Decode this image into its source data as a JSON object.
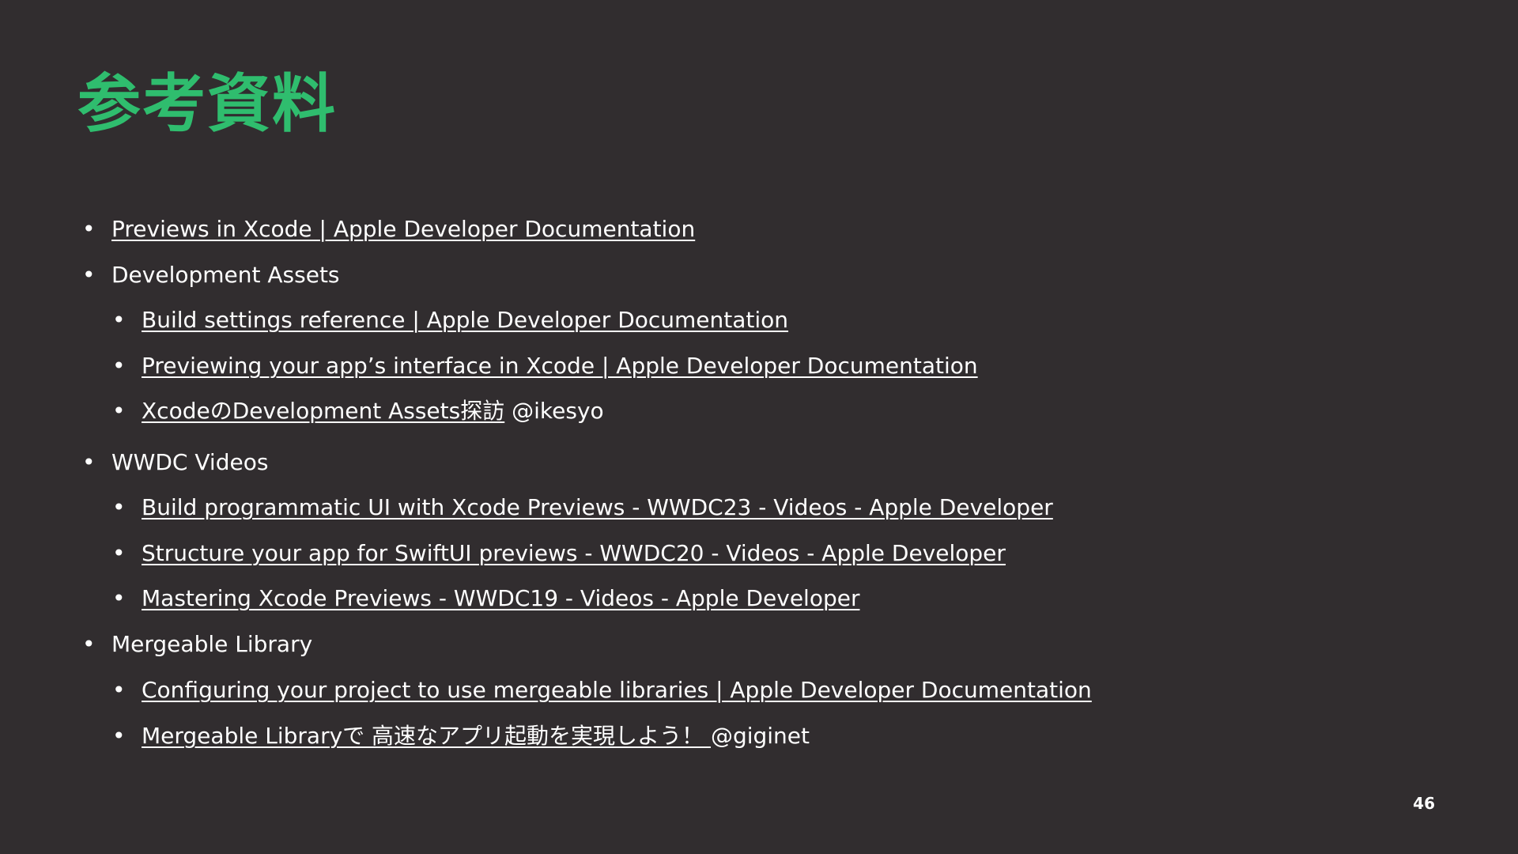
{
  "slide": {
    "title": "参考資料",
    "page_number": "46",
    "bullet_glyph": "•",
    "items": [
      {
        "level": 1,
        "link": "Previews in Xcode | Apple Developer Documentation",
        "suffix": ""
      },
      {
        "level": 1,
        "link": "",
        "text": "Development Assets"
      },
      {
        "level": 2,
        "link": "Build settings reference | Apple Developer Documentation",
        "suffix": ""
      },
      {
        "level": 2,
        "link": "Previewing your app’s interface in Xcode | Apple Developer Documentation",
        "suffix": ""
      },
      {
        "level": 2,
        "link": "XcodeのDevelopment Assets探訪",
        "suffix": " @ikesyo"
      },
      {
        "level": 1,
        "link": "",
        "text": "WWDC Videos"
      },
      {
        "level": 2,
        "link": "Build programmatic UI with Xcode Previews - WWDC23 - Videos - Apple Developer",
        "suffix": ""
      },
      {
        "level": 2,
        "link": "Structure your app for SwiftUI previews - WWDC20 - Videos - Apple Developer",
        "suffix": ""
      },
      {
        "level": 2,
        "link": "Mastering Xcode Previews - WWDC19 - Videos - Apple Developer",
        "suffix": ""
      },
      {
        "level": 1,
        "link": "",
        "text": "Mergeable Library"
      },
      {
        "level": 2,
        "link": "Configuring your project to use mergeable libraries | Apple Developer Documentation",
        "suffix": ""
      },
      {
        "level": 2,
        "link": "Mergeable Libraryで 高速なアプリ起動を実現しよう！ ",
        "suffix": " @giginet"
      }
    ]
  }
}
